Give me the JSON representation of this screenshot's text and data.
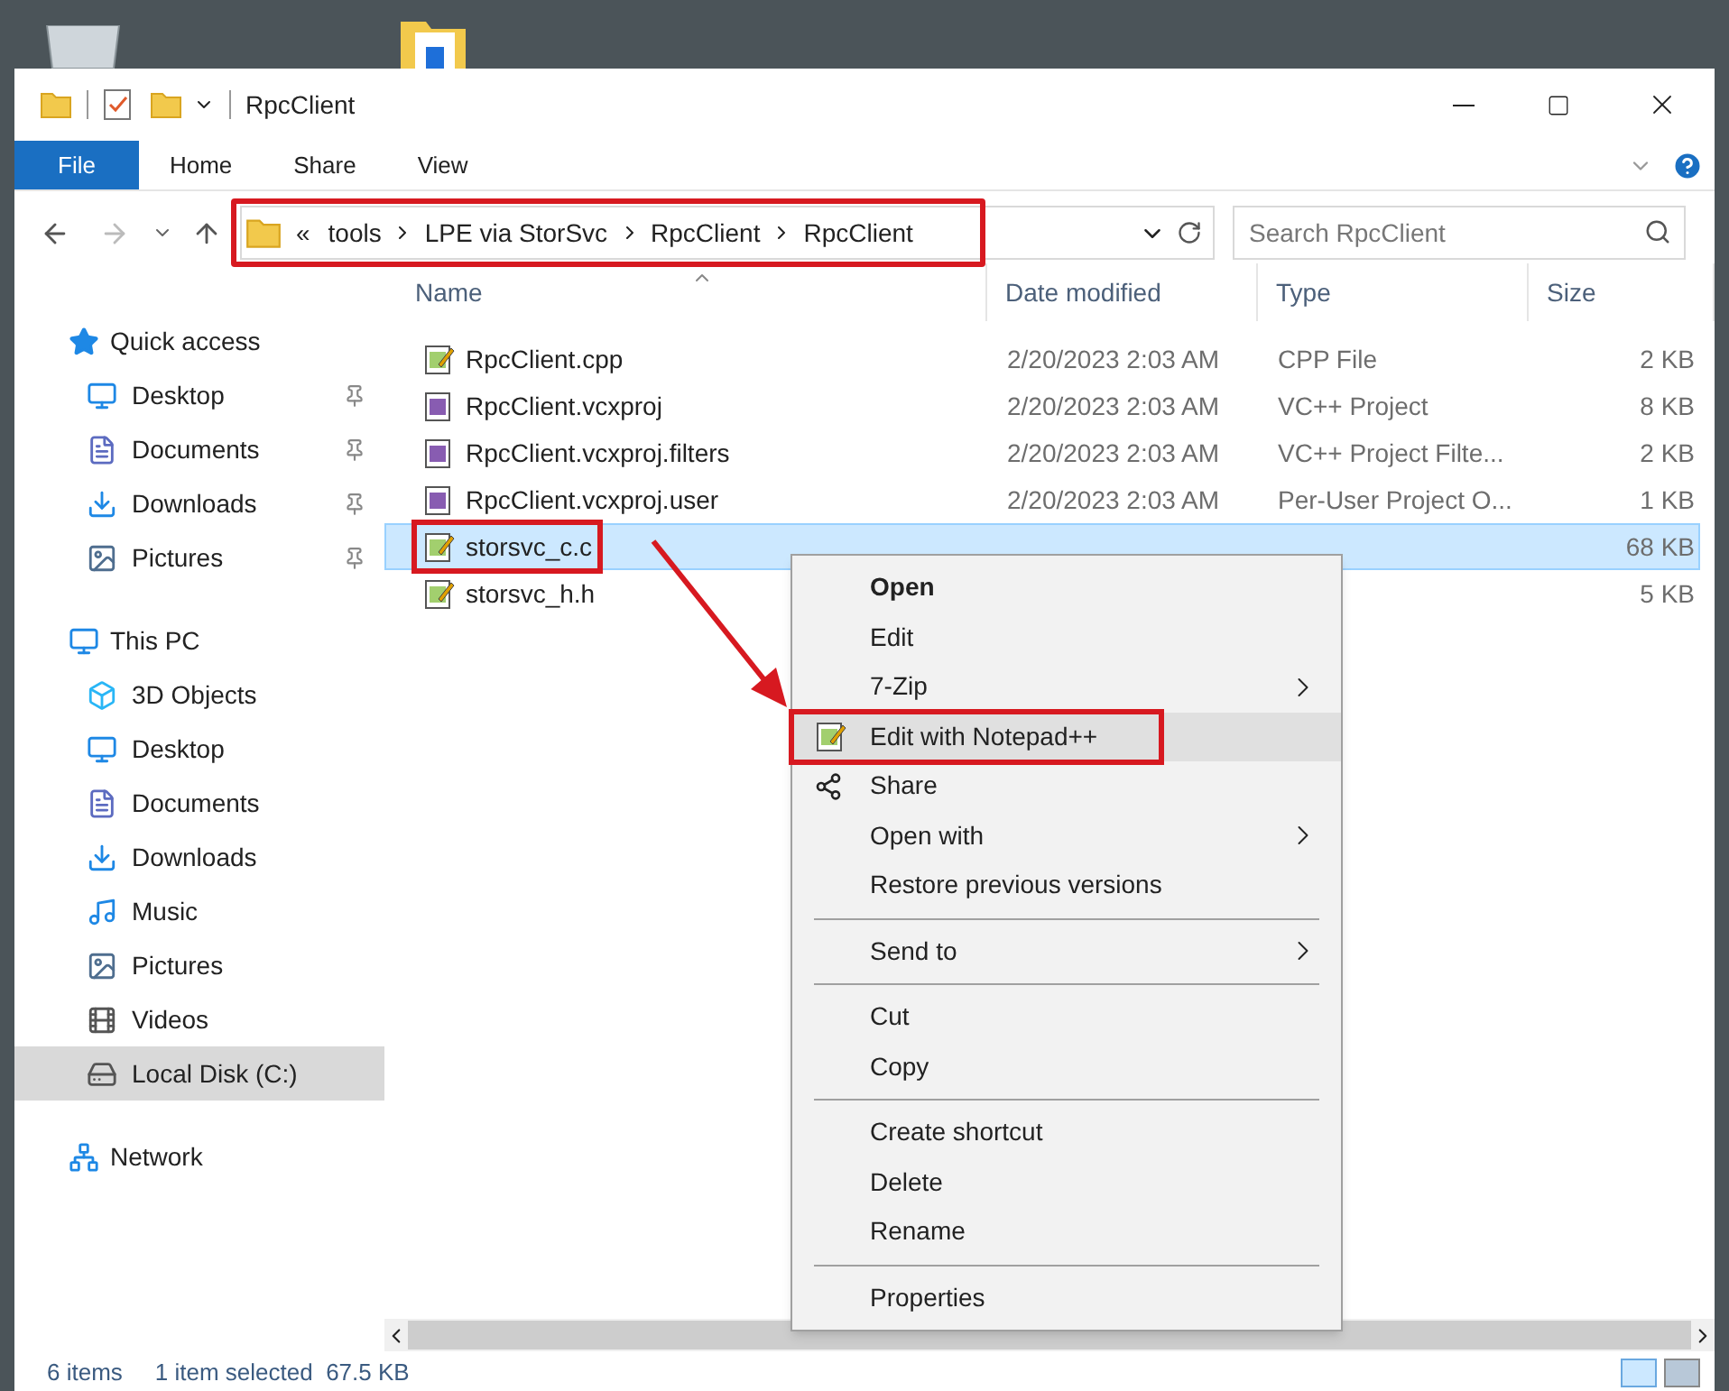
{
  "window": {
    "title": "RpcClient"
  },
  "ribbon_tabs": [
    {
      "label": "File",
      "selected": true
    },
    {
      "label": "Home",
      "selected": false
    },
    {
      "label": "Share",
      "selected": false
    },
    {
      "label": "View",
      "selected": false
    }
  ],
  "address": {
    "overflow": "«",
    "crumbs": [
      "tools",
      "LPE via StorSvc",
      "RpcClient",
      "RpcClient"
    ]
  },
  "search": {
    "placeholder": "Search RpcClient"
  },
  "sidebar": {
    "items": [
      {
        "label": "Quick access",
        "selected": false,
        "children": [
          {
            "label": "Desktop",
            "pinned": true,
            "selected": false
          },
          {
            "label": "Documents",
            "pinned": true,
            "selected": false
          },
          {
            "label": "Downloads",
            "pinned": true,
            "selected": false
          },
          {
            "label": "Pictures",
            "pinned": true,
            "selected": false
          }
        ]
      },
      {
        "label": "This PC",
        "selected": false,
        "children": [
          {
            "label": "3D Objects",
            "pinned": false,
            "selected": false
          },
          {
            "label": "Desktop",
            "pinned": false,
            "selected": false
          },
          {
            "label": "Documents",
            "pinned": false,
            "selected": false
          },
          {
            "label": "Downloads",
            "pinned": false,
            "selected": false
          },
          {
            "label": "Music",
            "pinned": false,
            "selected": false
          },
          {
            "label": "Pictures",
            "pinned": false,
            "selected": false
          },
          {
            "label": "Videos",
            "pinned": false,
            "selected": false
          },
          {
            "label": "Local Disk (C:)",
            "pinned": false,
            "selected": true
          }
        ]
      },
      {
        "label": "Network",
        "selected": false
      }
    ]
  },
  "table": {
    "columns": [
      "Name",
      "Date modified",
      "Type",
      "Size"
    ],
    "rows": [
      {
        "name": "RpcClient.cpp",
        "kind": "notepad",
        "date": "2/20/2023 2:03 AM",
        "type": "CPP File",
        "size": "2 KB",
        "selected": false
      },
      {
        "name": "RpcClient.vcxproj",
        "kind": "project",
        "date": "2/20/2023 2:03 AM",
        "type": "VC++ Project",
        "size": "8 KB",
        "selected": false
      },
      {
        "name": "RpcClient.vcxproj.filters",
        "kind": "filters",
        "date": "2/20/2023 2:03 AM",
        "type": "VC++ Project Filte...",
        "size": "2 KB",
        "selected": false
      },
      {
        "name": "RpcClient.vcxproj.user",
        "kind": "user",
        "date": "2/20/2023 2:03 AM",
        "type": "Per-User Project O...",
        "size": "1 KB",
        "selected": false
      },
      {
        "name": "storsvc_c.c",
        "kind": "notepad",
        "size": "68 KB",
        "selected": true
      },
      {
        "name": "storsvc_h.h",
        "kind": "notepad",
        "size": "5 KB",
        "selected": false
      }
    ]
  },
  "context_menu": [
    {
      "kind": "item",
      "label": "Open",
      "bold": true,
      "submenu": false,
      "highlighted": false
    },
    {
      "kind": "item",
      "label": "Edit",
      "bold": false,
      "submenu": false,
      "highlighted": false
    },
    {
      "kind": "item",
      "label": "7-Zip",
      "bold": false,
      "submenu": true,
      "highlighted": false
    },
    {
      "kind": "item",
      "label": "Edit with Notepad++",
      "bold": false,
      "submenu": false,
      "highlighted": true
    },
    {
      "kind": "item",
      "label": "Share",
      "bold": false,
      "submenu": false,
      "highlighted": false
    },
    {
      "kind": "item",
      "label": "Open with",
      "bold": false,
      "submenu": true,
      "highlighted": false
    },
    {
      "kind": "item",
      "label": "Restore previous versions",
      "bold": false,
      "submenu": false,
      "highlighted": false
    },
    {
      "kind": "separator"
    },
    {
      "kind": "item",
      "label": "Send to",
      "bold": false,
      "submenu": true,
      "highlighted": false
    },
    {
      "kind": "separator"
    },
    {
      "kind": "item",
      "label": "Cut",
      "bold": false,
      "submenu": false,
      "highlighted": false
    },
    {
      "kind": "item",
      "label": "Copy",
      "bold": false,
      "submenu": false,
      "highlighted": false
    },
    {
      "kind": "separator"
    },
    {
      "kind": "item",
      "label": "Create shortcut",
      "bold": false,
      "submenu": false,
      "highlighted": false
    },
    {
      "kind": "item",
      "label": "Delete",
      "bold": false,
      "submenu": false,
      "highlighted": false
    },
    {
      "kind": "item",
      "label": "Rename",
      "bold": false,
      "submenu": false,
      "highlighted": false
    },
    {
      "kind": "separator"
    },
    {
      "kind": "item",
      "label": "Properties",
      "bold": false,
      "submenu": false,
      "highlighted": false
    }
  ],
  "status_bar": {
    "count": "6 items",
    "selection": "1 item selected  67.5 KB"
  }
}
